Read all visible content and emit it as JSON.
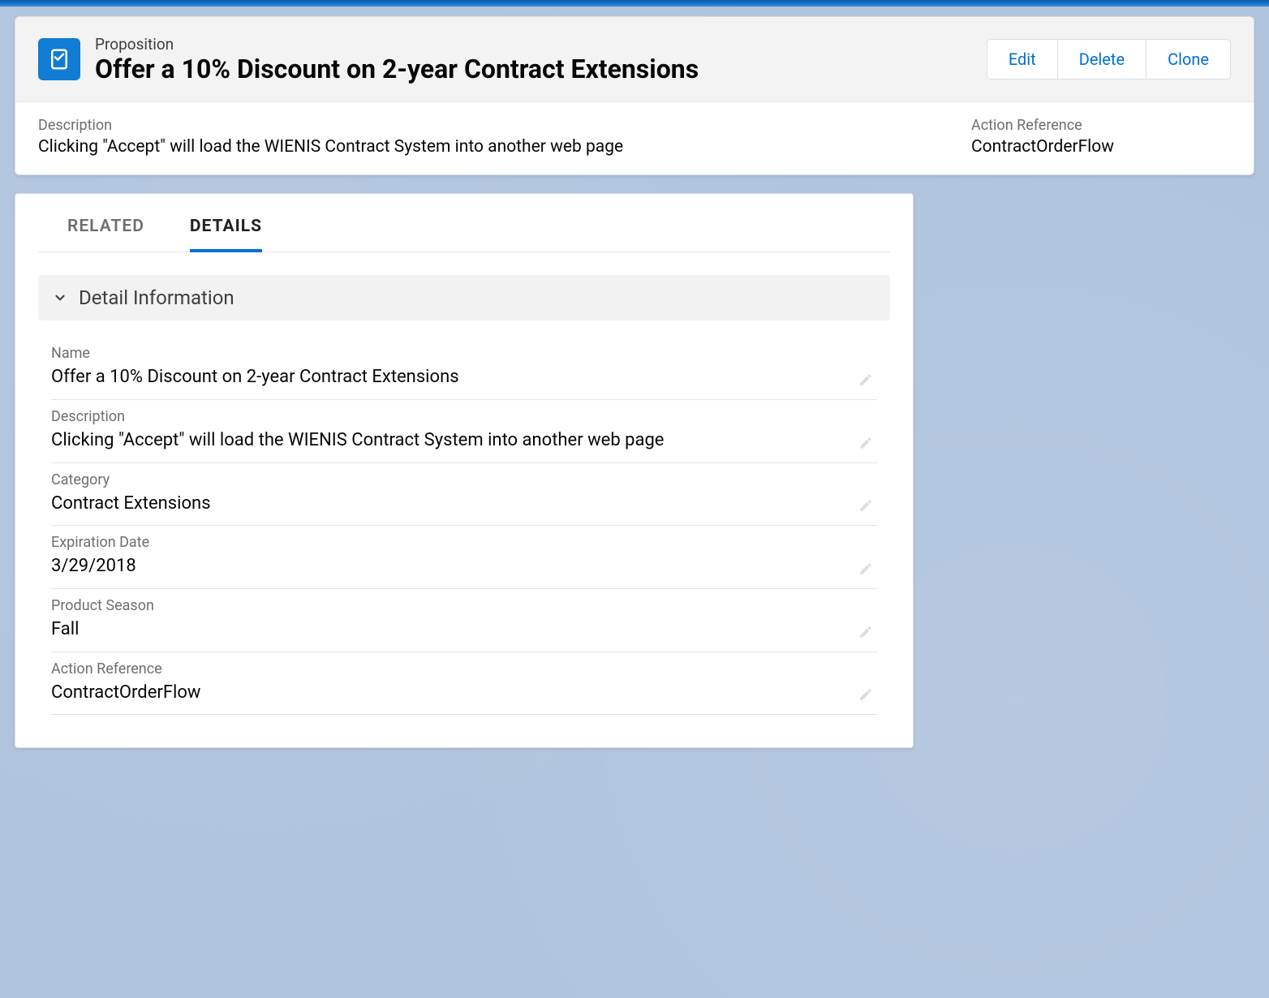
{
  "header": {
    "object_label": "Proposition",
    "record_title": "Offer a 10% Discount on 2-year Contract Extensions",
    "actions": {
      "edit": "Edit",
      "delete": "Delete",
      "clone": "Clone"
    },
    "summary": {
      "description_label": "Description",
      "description_value": "Clicking \"Accept\" will load the WIENIS Contract System into another web page",
      "action_ref_label": "Action Reference",
      "action_ref_value": "ContractOrderFlow"
    }
  },
  "tabs": {
    "related": "RELATED",
    "details": "DETAILS"
  },
  "section": {
    "title": "Detail Information"
  },
  "fields": {
    "name": {
      "label": "Name",
      "value": "Offer a 10% Discount on 2-year Contract Extensions"
    },
    "description": {
      "label": "Description",
      "value": "Clicking \"Accept\" will load the WIENIS Contract System into another web page"
    },
    "category": {
      "label": "Category",
      "value": "Contract Extensions"
    },
    "expiration": {
      "label": "Expiration Date",
      "value": "3/29/2018"
    },
    "season": {
      "label": "Product Season",
      "value": "Fall"
    },
    "action_ref": {
      "label": "Action Reference",
      "value": "ContractOrderFlow"
    }
  }
}
